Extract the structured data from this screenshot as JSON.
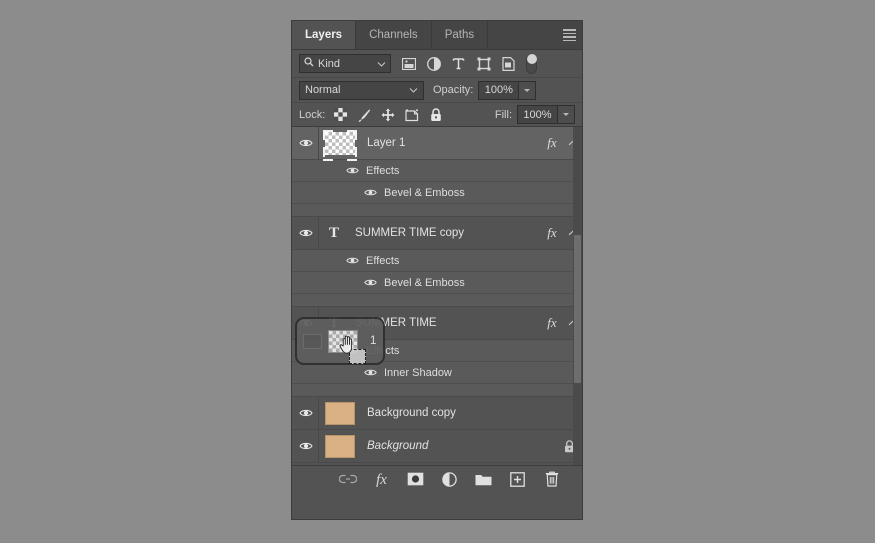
{
  "panel": {
    "tabs": [
      {
        "label": "Layers",
        "active": true,
        "name": "tab-layers"
      },
      {
        "label": "Channels",
        "active": false,
        "name": "tab-channels"
      },
      {
        "label": "Paths",
        "active": false,
        "name": "tab-paths"
      }
    ],
    "menu_icon": "hamburger-menu-icon"
  },
  "filter": {
    "kind_label": "Kind",
    "search_icon": "search-icon",
    "dropdown_icon": "chevron-down-icon",
    "icons": [
      {
        "name": "filter-pixel-layers-icon",
        "title": "Pixel layers"
      },
      {
        "name": "filter-adjustment-layers-icon",
        "title": "Adjustment layers"
      },
      {
        "name": "filter-type-layers-icon",
        "title": "Type layers"
      },
      {
        "name": "filter-shape-layers-icon",
        "title": "Shape layers"
      },
      {
        "name": "filter-smart-object-icon",
        "title": "Smart objects"
      }
    ],
    "toggle_name": "filter-enable-toggle"
  },
  "blend": {
    "mode": "Normal",
    "opacity_label": "Opacity:",
    "opacity_value": "100%"
  },
  "lock": {
    "label": "Lock:",
    "icons": [
      {
        "name": "lock-transparent-pixels-icon"
      },
      {
        "name": "lock-image-pixels-icon"
      },
      {
        "name": "lock-position-icon"
      },
      {
        "name": "lock-artboard-nesting-icon"
      },
      {
        "name": "lock-all-icon"
      }
    ],
    "fill_label": "Fill:",
    "fill_value": "100%"
  },
  "layers": [
    {
      "name": "Layer 1",
      "type": "pixel",
      "selected": true,
      "visible": true,
      "has_fx": true,
      "fx_label": "fx",
      "thumb": "checker",
      "locked": false,
      "italic": false,
      "effects_group_label": "Effects",
      "effects": [
        "Bevel & Emboss"
      ]
    },
    {
      "name": "SUMMER TIME copy",
      "type": "text",
      "type_glyph": "T",
      "selected": false,
      "visible": true,
      "has_fx": true,
      "fx_label": "fx",
      "thumb": "none",
      "locked": false,
      "italic": false,
      "effects_group_label": "Effects",
      "effects": [
        "Bevel & Emboss"
      ]
    },
    {
      "name": "SUMMER TIME",
      "type": "text",
      "type_glyph": "T",
      "selected": false,
      "visible": true,
      "has_fx": true,
      "fx_label": "fx",
      "thumb": "none",
      "locked": false,
      "italic": false,
      "effects_group_label": "Effects",
      "effects": [
        "Inner Shadow"
      ]
    },
    {
      "name": "Background copy",
      "type": "pixel",
      "selected": false,
      "visible": true,
      "has_fx": false,
      "thumb": "tan",
      "locked": false,
      "italic": false,
      "effects": []
    },
    {
      "name": "Background",
      "type": "pixel",
      "selected": false,
      "visible": true,
      "has_fx": false,
      "thumb": "tan",
      "locked": true,
      "italic": true,
      "effects": []
    }
  ],
  "drag_ghost": {
    "label": "1",
    "cursor_icon": "hand-cursor-icon",
    "thumb": "checker",
    "visible": true
  },
  "bottom_toolbar": [
    {
      "name": "link-layers-button",
      "icon": "link-icon"
    },
    {
      "name": "add-layer-style-button",
      "icon": "fx-icon",
      "label": "fx"
    },
    {
      "name": "add-layer-mask-button",
      "icon": "layer-mask-icon"
    },
    {
      "name": "new-fill-adjustment-layer-button",
      "icon": "adjustment-circle-icon"
    },
    {
      "name": "new-group-button",
      "icon": "folder-icon"
    },
    {
      "name": "new-layer-button",
      "icon": "new-layer-icon"
    },
    {
      "name": "delete-layer-button",
      "icon": "trash-icon"
    }
  ],
  "colors": {
    "panel_bg": "#535353",
    "tabbar_bg": "#454545",
    "selected_row": "#636363",
    "effects_row": "#5a5a5a",
    "field_bg": "#454545",
    "text": "#d8d8d8",
    "thumb_tan": "#d9b184",
    "canvas_bg": "#8c8c8c"
  }
}
